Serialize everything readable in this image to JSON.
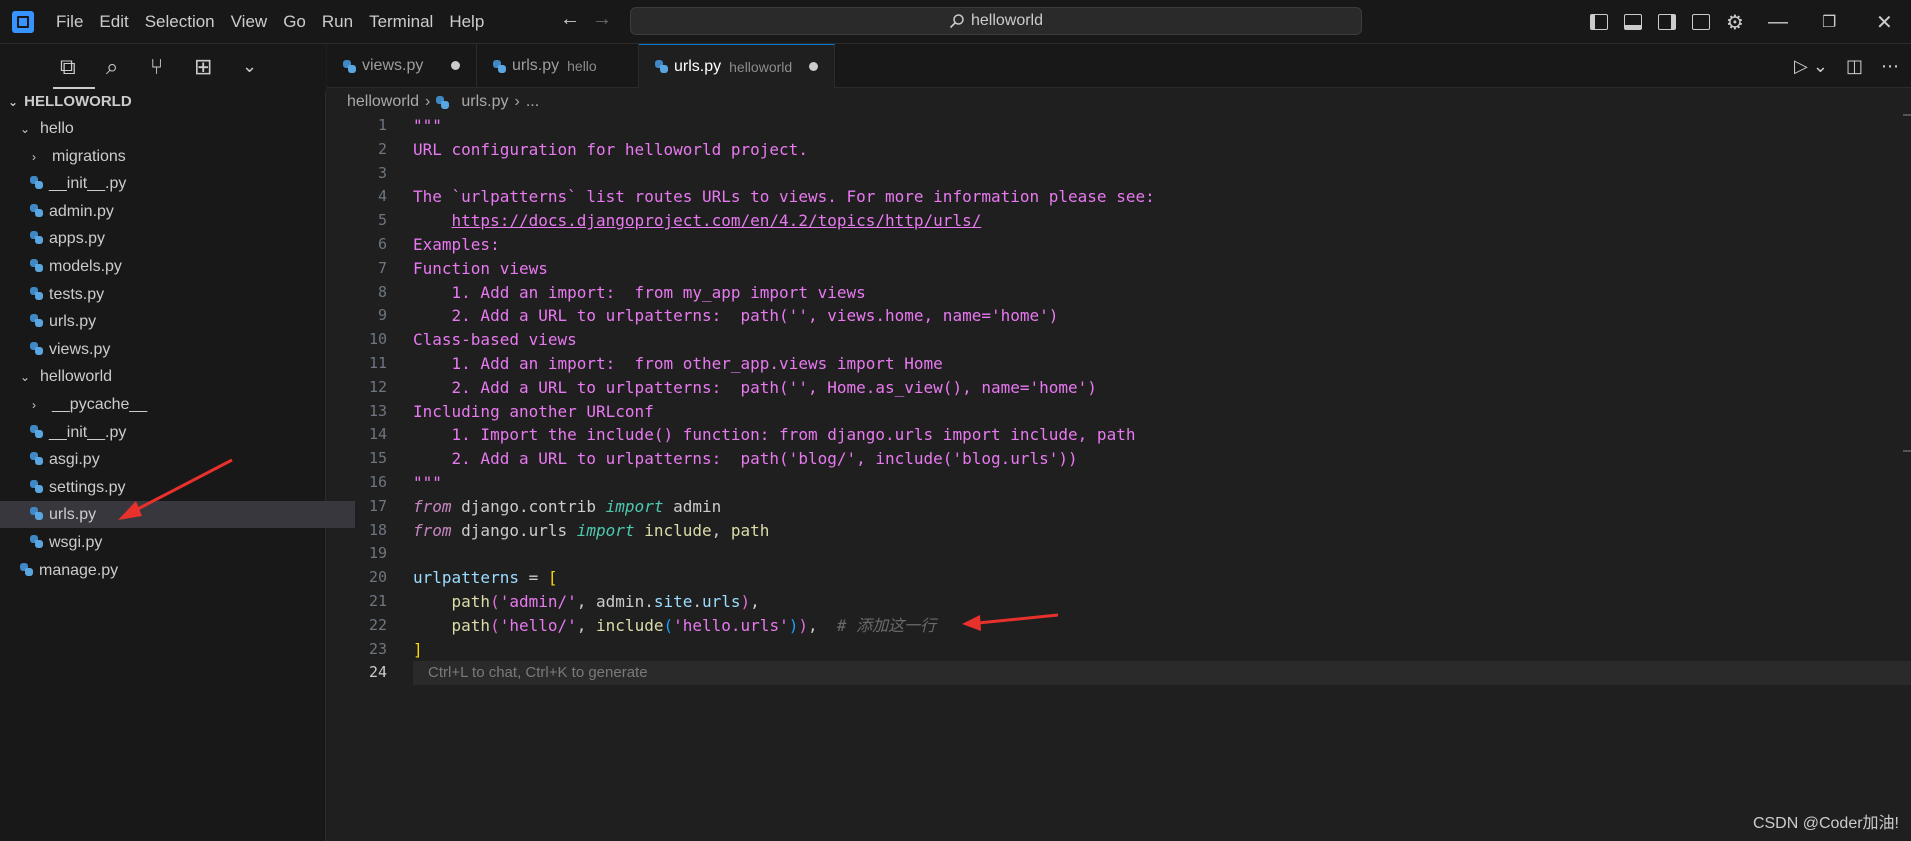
{
  "menu": [
    "File",
    "Edit",
    "Selection",
    "View",
    "Go",
    "Run",
    "Terminal",
    "Help"
  ],
  "search": {
    "text": "helloworld"
  },
  "explorer": {
    "root": "HELLOWORLD",
    "items": [
      {
        "label": "hello",
        "type": "folder-open",
        "depth": 1
      },
      {
        "label": "migrations",
        "type": "folder",
        "depth": 2
      },
      {
        "label": "__init__.py",
        "type": "py",
        "depth": 2
      },
      {
        "label": "admin.py",
        "type": "py",
        "depth": 2
      },
      {
        "label": "apps.py",
        "type": "py",
        "depth": 2
      },
      {
        "label": "models.py",
        "type": "py",
        "depth": 2
      },
      {
        "label": "tests.py",
        "type": "py",
        "depth": 2
      },
      {
        "label": "urls.py",
        "type": "py",
        "depth": 2
      },
      {
        "label": "views.py",
        "type": "py",
        "depth": 2
      },
      {
        "label": "helloworld",
        "type": "folder-open",
        "depth": 1
      },
      {
        "label": "__pycache__",
        "type": "folder",
        "depth": 2
      },
      {
        "label": "__init__.py",
        "type": "py",
        "depth": 2
      },
      {
        "label": "asgi.py",
        "type": "py",
        "depth": 2
      },
      {
        "label": "settings.py",
        "type": "py",
        "depth": 2
      },
      {
        "label": "urls.py",
        "type": "py",
        "depth": 2,
        "selected": true
      },
      {
        "label": "wsgi.py",
        "type": "py",
        "depth": 2
      },
      {
        "label": "manage.py",
        "type": "py",
        "depth": 1
      }
    ]
  },
  "tabs": [
    {
      "label": "views.py",
      "desc": "",
      "modified": true
    },
    {
      "label": "urls.py",
      "desc": "hello",
      "modified": false
    },
    {
      "label": "urls.py",
      "desc": "helloworld",
      "modified": true,
      "active": true
    }
  ],
  "breadcrumb": {
    "folder": "helloworld",
    "file": "urls.py",
    "more": "..."
  },
  "code": [
    "\"\"\"",
    "URL configuration for helloworld project.",
    "",
    "The `urlpatterns` list routes URLs to views. For more information please see:",
    "    https://docs.djangoproject.com/en/4.2/topics/http/urls/",
    "Examples:",
    "Function views",
    "    1. Add an import:  from my_app import views",
    "    2. Add a URL to urlpatterns:  path('', views.home, name='home')",
    "Class-based views",
    "    1. Add an import:  from other_app.views import Home",
    "    2. Add a URL to urlpatterns:  path('', Home.as_view(), name='home')",
    "Including another URLconf",
    "    1. Import the include() function: from django.urls import include, path",
    "    2. Add a URL to urlpatterns:  path('blog/', include('blog.urls'))",
    "\"\"\"",
    "from django.contrib import admin",
    "from django.urls import include, path",
    "",
    "urlpatterns = [",
    "    path('admin/', admin.site.urls),",
    "    path('hello/', include('hello.urls')),  # 添加这一行",
    "]",
    ""
  ],
  "active_line": 24,
  "hint": "Ctrl+L to chat, Ctrl+K to generate",
  "watermark": "CSDN @Coder加油!",
  "colors": {
    "accent": "#0078d4",
    "annotation_arrow": "#e8302c",
    "docstring": "#e879f0"
  }
}
